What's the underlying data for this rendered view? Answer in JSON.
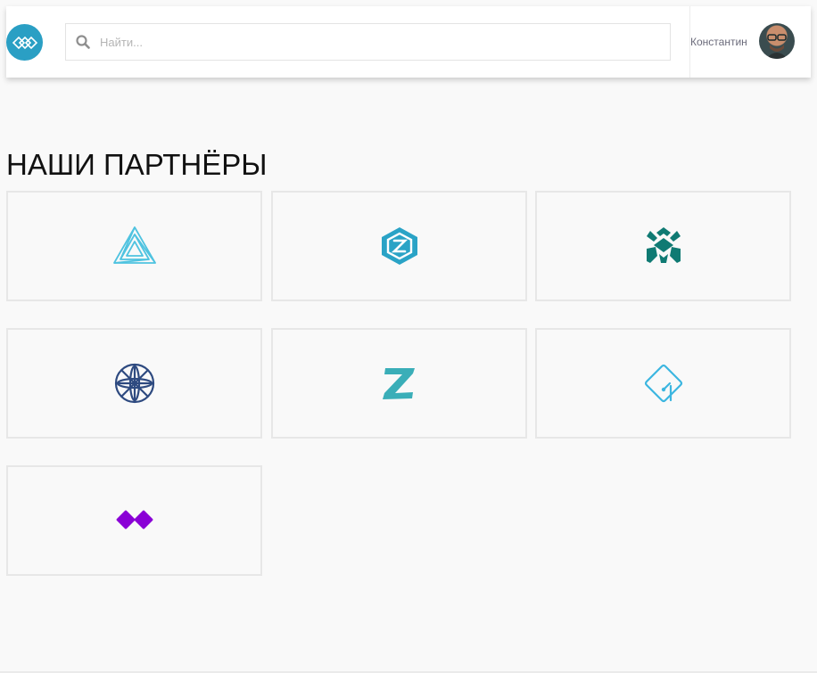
{
  "header": {
    "logo": "diamond-lattice-logo",
    "search": {
      "placeholder": "Найти...",
      "value": "",
      "icon": "search-icon"
    },
    "user": {
      "name": "Константин",
      "avatar": "avatar"
    }
  },
  "main": {
    "title": "НАШИ ПАРТНЁРЫ",
    "partners": [
      {
        "logo": "impossible-triangle-logo",
        "color": "#4fc3e0"
      },
      {
        "logo": "hexagon-logo",
        "color": "#2aa3c6"
      },
      {
        "logo": "tribal-mask-logo",
        "color": "#0f7a73"
      },
      {
        "logo": "flower-circle-logo",
        "color": "#2e4a80"
      },
      {
        "logo": "z-letter-logo",
        "color": "#3aaeb8"
      },
      {
        "logo": "rounded-diamond-logo",
        "color": "#3cb6e0"
      },
      {
        "logo": "double-diamond-logo",
        "color": "#8a00d6"
      }
    ]
  }
}
